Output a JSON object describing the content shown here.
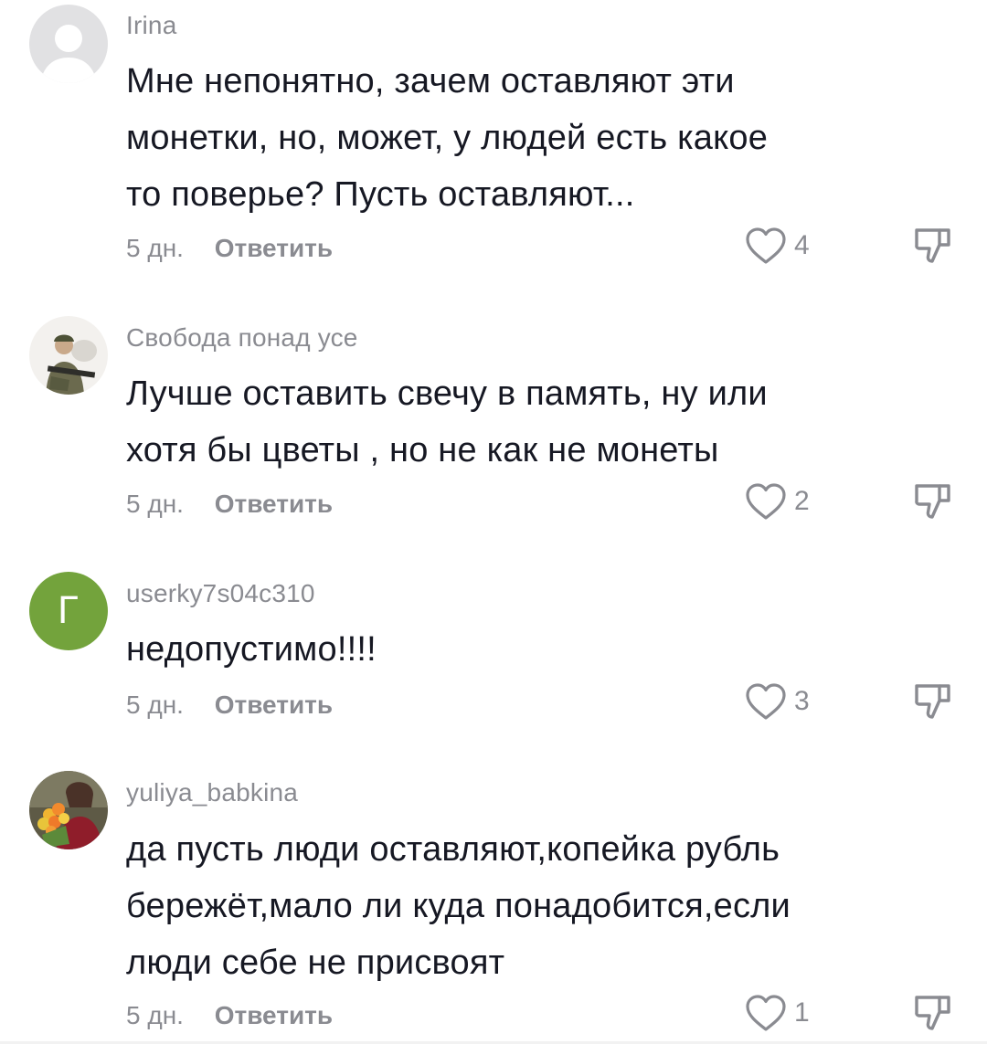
{
  "comments": [
    {
      "username": "Irina",
      "avatar": "default-avatar",
      "text_lines": [
        "Мне непонятно, зачем оставляют эти",
        "монетки, но, может, у людей есть какое",
        "то поверье? Пусть оставляют..."
      ],
      "time": "5 дн.",
      "reply_label": "Ответить",
      "likes": "4"
    },
    {
      "username": "Свобода понад усе",
      "avatar": "soldier-photo-avatar",
      "text_lines": [
        "Лучше оставить свечу в память, ну или",
        "хотя бы цветы , но не как не монеты"
      ],
      "time": "5 дн.",
      "reply_label": "Ответить",
      "likes": "2"
    },
    {
      "username": "userky7s04c310",
      "avatar_letter": "Г",
      "avatar_color": "#73a33c",
      "text_lines": [
        "недопустимо!!!!"
      ],
      "time": "5 дн.",
      "reply_label": "Ответить",
      "likes": "3"
    },
    {
      "username": "yuliya_babkina",
      "avatar": "flowers-photo-avatar",
      "text_lines": [
        "да пусть люди оставляют,копейка рубль",
        "бережёт,мало ли куда понадобится,если",
        "люди себе не присвоят"
      ],
      "time": "5 дн.",
      "reply_label": "Ответить",
      "likes": "1"
    }
  ],
  "icons": {
    "like": "heart-outline-icon",
    "dislike": "thumbs-down-icon"
  },
  "colors": {
    "secondary_text": "#8a8b91",
    "primary_text": "#161823",
    "letter_avatar": "#73a33c"
  }
}
